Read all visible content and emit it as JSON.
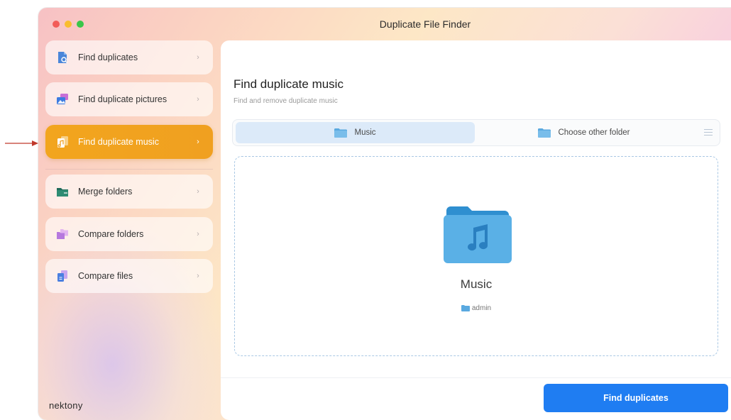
{
  "window": {
    "title": "Duplicate File Finder"
  },
  "sidebar": {
    "items": [
      {
        "label": "Find duplicates",
        "icon": "file-search-icon",
        "active": false
      },
      {
        "label": "Find duplicate pictures",
        "icon": "pictures-icon",
        "active": false
      },
      {
        "label": "Find duplicate music",
        "icon": "music-file-icon",
        "active": true
      },
      {
        "label": "Merge folders",
        "icon": "merge-folders-icon",
        "active": false
      },
      {
        "label": "Compare folders",
        "icon": "compare-folders-icon",
        "active": false
      },
      {
        "label": "Compare files",
        "icon": "compare-files-icon",
        "active": false
      }
    ],
    "chevron": "›",
    "logo": "nektony"
  },
  "main": {
    "title": "Find duplicate music",
    "subtitle": "Find and remove duplicate music",
    "tabs": [
      {
        "label": "Music",
        "selected": true
      },
      {
        "label": "Choose other folder",
        "selected": false
      }
    ],
    "folder": {
      "name": "Music",
      "path": "admin"
    },
    "find_button": "Find duplicates"
  },
  "colors": {
    "accent": "#1f7df2",
    "active_item": "#f2a51e",
    "folder": "#5aa9e0",
    "arrow": "#c0392b"
  }
}
